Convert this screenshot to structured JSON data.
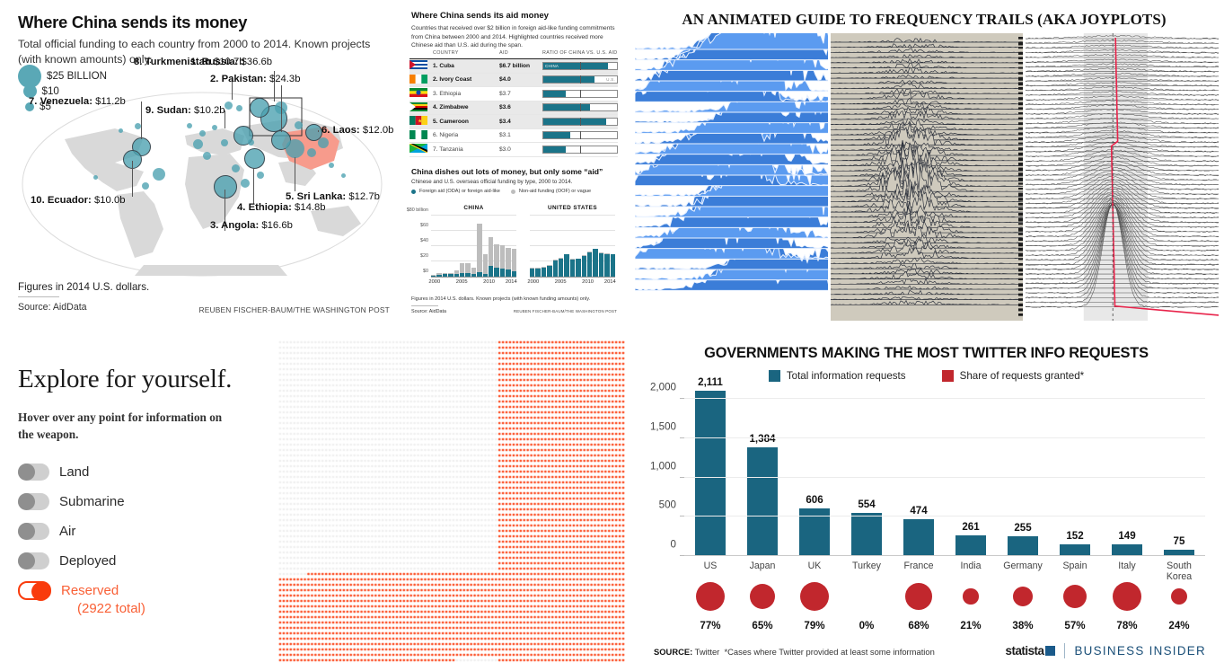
{
  "wapo_map": {
    "title": "Where China sends its money",
    "subtitle": "Total official funding to each country from 2000 to 2014. Known projects (with known amounts) only.",
    "legend": [
      {
        "label": "$25 BILLION",
        "size": 26
      },
      {
        "label": "$10",
        "size": 15
      },
      {
        "label": "$5",
        "size": 10
      }
    ],
    "labels": [
      {
        "rank": "1.",
        "country": "Russia:",
        "value": "$36.6b"
      },
      {
        "rank": "2.",
        "country": "Pakistan:",
        "value": "$24.3b"
      },
      {
        "rank": "3.",
        "country": "Angola:",
        "value": "$16.6b"
      },
      {
        "rank": "4.",
        "country": "Ethiopia:",
        "value": "$14.8b"
      },
      {
        "rank": "5.",
        "country": "Sri Lanka:",
        "value": "$12.7b"
      },
      {
        "rank": "6.",
        "country": "Laos:",
        "value": "$12.0b"
      },
      {
        "rank": "7.",
        "country": "Venezuela:",
        "value": "$11.2b"
      },
      {
        "rank": "8.",
        "country": "Turkmenistan",
        "value": "$10.7b"
      },
      {
        "rank": "9.",
        "country": "Sudan:",
        "value": "$10.2b"
      },
      {
        "rank": "10.",
        "country": "Ecuador:",
        "value": "$10.0b"
      }
    ],
    "footnote": "Figures in 2014 U.S. dollars.",
    "source": "Source: AidData",
    "credit": "REUBEN FISCHER-BAUM/THE WASHINGTON POST",
    "bubble_color": "#4aa0b0"
  },
  "aid_table": {
    "title": "Where China sends its aid money",
    "subtitle": "Countries that received over $2 billion in foreign aid-like funding commitments from China between 2000 and 2014. Highlighted countries received more Chinese aid than U.S. aid during the span.",
    "headers": [
      "COUNTRY",
      "AID",
      "RATIO OF CHINA VS. U.S. AID"
    ],
    "rows": [
      {
        "rank": "1. Cuba",
        "aid": "$6.7 billion",
        "ratio": 88,
        "highlight": true,
        "tag_china": "CHINA",
        "tag_us": "",
        "flag": "cuba"
      },
      {
        "rank": "2. Ivory Coast",
        "aid": "$4.0",
        "ratio": 70,
        "highlight": true,
        "tag_china": "",
        "tag_us": "U.S.",
        "flag": "ivory"
      },
      {
        "rank": "3. Ethiopia",
        "aid": "$3.7",
        "ratio": 30,
        "highlight": false,
        "tag_china": "",
        "tag_us": "",
        "flag": "ethiopia"
      },
      {
        "rank": "4. Zimbabwe",
        "aid": "$3.6",
        "ratio": 63,
        "highlight": true,
        "tag_china": "",
        "tag_us": "",
        "flag": "zimbabwe"
      },
      {
        "rank": "5. Cameroon",
        "aid": "$3.4",
        "ratio": 85,
        "highlight": true,
        "tag_china": "",
        "tag_us": "",
        "flag": "cameroon"
      },
      {
        "rank": "6. Nigeria",
        "aid": "$3.1",
        "ratio": 37,
        "highlight": false,
        "tag_china": "",
        "tag_us": "",
        "flag": "nigeria"
      },
      {
        "rank": "7. Tanzania",
        "aid": "$3.0",
        "ratio": 31,
        "highlight": false,
        "tag_china": "",
        "tag_us": "",
        "flag": "tanzania"
      }
    ],
    "chart_title": "China dishes out lots of money, but only some “aid”",
    "chart_sub": "Chinese and U.S. overseas official funding by type, 2000 to 2014.",
    "legend_aid": "Foreign aid (ODA) or foreign aid-like",
    "legend_oof": "Non-aid funding (OOF) or vague",
    "footnote": "Figures in 2014 U.S. dollars. Known projects (with known funding amounts) only.",
    "source": "Source: AidData",
    "credit": "REUBEN FISCHER-BAUM/THE WASHINGTON POST"
  },
  "chart_data": [
    {
      "type": "bar",
      "title": "GOVERNMENTS MAKING THE MOST TWITTER INFO REQUESTS",
      "legend": [
        "Total information requests",
        "Share of requests granted*"
      ],
      "legend_position": "top",
      "categories": [
        "US",
        "Japan",
        "UK",
        "Turkey",
        "France",
        "India",
        "Germany",
        "Spain",
        "Italy",
        "South Korea"
      ],
      "series": [
        {
          "name": "Total information requests",
          "values": [
            2111,
            1384,
            606,
            554,
            474,
            261,
            255,
            152,
            149,
            75
          ],
          "color": "#1a6580"
        },
        {
          "name": "Share of requests granted*",
          "values": [
            77,
            65,
            79,
            0,
            68,
            21,
            38,
            57,
            78,
            24
          ],
          "color": "#c1272d",
          "unit": "%"
        }
      ],
      "value_labels": [
        "2,111",
        "1,384",
        "606",
        "554",
        "474",
        "261",
        "255",
        "152",
        "149",
        "75"
      ],
      "percent_labels": [
        "77%",
        "65%",
        "79%",
        "0%",
        "68%",
        "21%",
        "38%",
        "57%",
        "78%",
        "24%"
      ],
      "yticks": [
        "0",
        "500",
        "1,000",
        "1,500",
        "2,000"
      ],
      "ytick_values": [
        0,
        500,
        1000,
        1500,
        2000
      ],
      "ylim": [
        0,
        2200
      ],
      "xlabel": "",
      "ylabel": "",
      "grid": true,
      "source": "Twitter",
      "source_prefix": "SOURCE:",
      "note": "*Cases where Twitter provided at least some information",
      "brand_statista": "statista",
      "brand_bi": "BUSINESS INSIDER"
    },
    {
      "type": "bar",
      "title": "CHINA",
      "ylabel": "$80 billion",
      "yticks": [
        "$80 billion",
        "$60",
        "$40",
        "$20",
        "$0"
      ],
      "ylim": [
        0,
        80
      ],
      "x": [
        "2000",
        "2001",
        "2002",
        "2003",
        "2004",
        "2005",
        "2006",
        "2007",
        "2008",
        "2009",
        "2010",
        "2011",
        "2012",
        "2013",
        "2014"
      ],
      "xticks": [
        "2000",
        "2005",
        "2010",
        "2014"
      ],
      "series": [
        {
          "name": "Foreign aid (ODA) or foreign aid-like",
          "color": "#1b7489",
          "values": [
            1,
            2,
            3,
            3,
            3,
            5,
            5,
            4,
            6,
            4,
            14,
            12,
            11,
            9,
            7
          ]
        },
        {
          "name": "Non-aid funding (OOF) or vague",
          "color": "#bdbdbd",
          "values": [
            1,
            3,
            2,
            2,
            5,
            13,
            13,
            8,
            64,
            26,
            38,
            30,
            30,
            29,
            30
          ]
        }
      ]
    },
    {
      "type": "bar",
      "title": "UNITED STATES",
      "ylim": [
        0,
        80
      ],
      "x": [
        "2000",
        "2001",
        "2002",
        "2003",
        "2004",
        "2005",
        "2006",
        "2007",
        "2008",
        "2009",
        "2010",
        "2011",
        "2012",
        "2013",
        "2014"
      ],
      "xticks": [
        "2000",
        "2005",
        "2010",
        "2014"
      ],
      "series": [
        {
          "name": "Foreign aid (ODA) or foreign aid-like",
          "color": "#1b7489",
          "values": [
            11,
            11,
            12,
            14,
            21,
            24,
            29,
            22,
            23,
            27,
            32,
            36,
            31,
            30,
            29
          ]
        },
        {
          "name": "Non-aid funding (OOF) or vague",
          "color": "#bdbdbd",
          "values": [
            1,
            1,
            1,
            1,
            1,
            1,
            1,
            1,
            1,
            1,
            1,
            1,
            1,
            1,
            1
          ]
        }
      ]
    }
  ],
  "joyplot": {
    "title": "AN ANIMATED GUIDE TO FREQUENCY TRAILS (AKA JOYPLOTS)",
    "panels": [
      "blue-ridgeline-plot",
      "unknown-pleasures-pulsar-plot",
      "grayscale-frequency-trail-plot"
    ]
  },
  "explore": {
    "title": "Explore for yourself.",
    "instruction": "Hover over any point for information on the weapon.",
    "toggles": [
      {
        "label": "Land",
        "on": false
      },
      {
        "label": "Submarine",
        "on": false
      },
      {
        "label": "Air",
        "on": false
      },
      {
        "label": "Deployed",
        "on": false
      },
      {
        "label": "Reserved",
        "on": true,
        "sublabel": "(2922 total)"
      }
    ],
    "accent_color": "#f96036"
  },
  "dot_grid": {
    "active_color": "#fb3b0c",
    "inactive_color": "#eeeeee",
    "cols": 98,
    "rows": 60
  },
  "twitter_chart": {
    "title": "GOVERNMENTS MAKING THE MOST TWITTER INFO REQUESTS",
    "legend1": "Total information requests",
    "legend2": "Share of requests granted*",
    "source_prefix": "SOURCE:",
    "source": "Twitter",
    "note": "*Cases where Twitter provided at least some information",
    "statista": "statista",
    "bi": "BUSINESS INSIDER"
  }
}
